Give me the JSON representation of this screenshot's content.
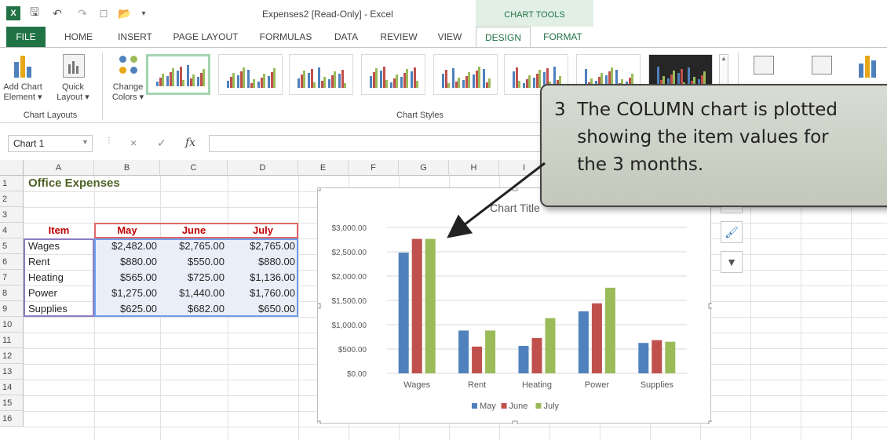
{
  "titlebar": {
    "window_title": "Expenses2  [Read-Only] - Excel",
    "chart_tools": "CHART TOOLS"
  },
  "tabs": [
    {
      "label": "FILE"
    },
    {
      "label": "HOME"
    },
    {
      "label": "INSERT"
    },
    {
      "label": "PAGE LAYOUT"
    },
    {
      "label": "FORMULAS"
    },
    {
      "label": "DATA"
    },
    {
      "label": "REVIEW"
    },
    {
      "label": "VIEW"
    },
    {
      "label": "DESIGN"
    },
    {
      "label": "FORMAT"
    }
  ],
  "ribbon": {
    "add_chart_element": "Add Chart\nElement ▾",
    "quick_layout": "Quick\nLayout ▾",
    "change_colors": "Change\nColors ▾",
    "group_chart_layouts": "Chart Layouts",
    "group_chart_styles": "Chart Styles"
  },
  "formula_bar": {
    "name_box": "Chart 1",
    "cancel": "×",
    "enter": "✓",
    "fx": "fx",
    "formula": ""
  },
  "sheet": {
    "columns": [
      "A",
      "B",
      "C",
      "D",
      "E",
      "F",
      "G",
      "H",
      "I"
    ],
    "rows": [
      "1",
      "2",
      "3",
      "4",
      "5",
      "6",
      "7",
      "8",
      "9",
      "10",
      "11",
      "12",
      "13",
      "14",
      "15",
      "16"
    ],
    "title": "Office Expenses",
    "headers": [
      "Item",
      "May",
      "June",
      "July"
    ],
    "data": [
      {
        "item": "Wages",
        "may": "$2,482.00",
        "june": "$2,765.00",
        "july": "$2,765.00"
      },
      {
        "item": "Rent",
        "may": "$880.00",
        "june": "$550.00",
        "july": "$880.00"
      },
      {
        "item": "Heating",
        "may": "$565.00",
        "june": "$725.00",
        "july": "$1,136.00"
      },
      {
        "item": "Power",
        "may": "$1,275.00",
        "june": "$1,440.00",
        "july": "$1,760.00"
      },
      {
        "item": "Supplies",
        "may": "$625.00",
        "june": "$682.00",
        "july": "$650.00"
      }
    ]
  },
  "colors": {
    "excel_green": "#217346",
    "may": "#4f81bd",
    "june": "#c0504d",
    "july": "#9bbb59",
    "header_red": "#c00000"
  },
  "chart_data": {
    "type": "bar",
    "title": "Chart Title",
    "categories": [
      "Wages",
      "Rent",
      "Heating",
      "Power",
      "Supplies"
    ],
    "series": [
      {
        "name": "May",
        "values": [
          2482,
          880,
          565,
          1275,
          625
        ]
      },
      {
        "name": "June",
        "values": [
          2765,
          550,
          725,
          1440,
          682
        ]
      },
      {
        "name": "July",
        "values": [
          2765,
          880,
          1136,
          1760,
          650
        ]
      }
    ],
    "yticks": [
      "$0.00",
      "$500.00",
      "$1,000.00",
      "$1,500.00",
      "$2,000.00",
      "$2,500.00",
      "$3,000.00"
    ],
    "ylim": [
      0,
      3000
    ],
    "legend": "bottom",
    "grid": true
  },
  "callout": {
    "text": "3  The COLUMN chart is plotted\n    showing the item values for\n    the 3 months."
  }
}
